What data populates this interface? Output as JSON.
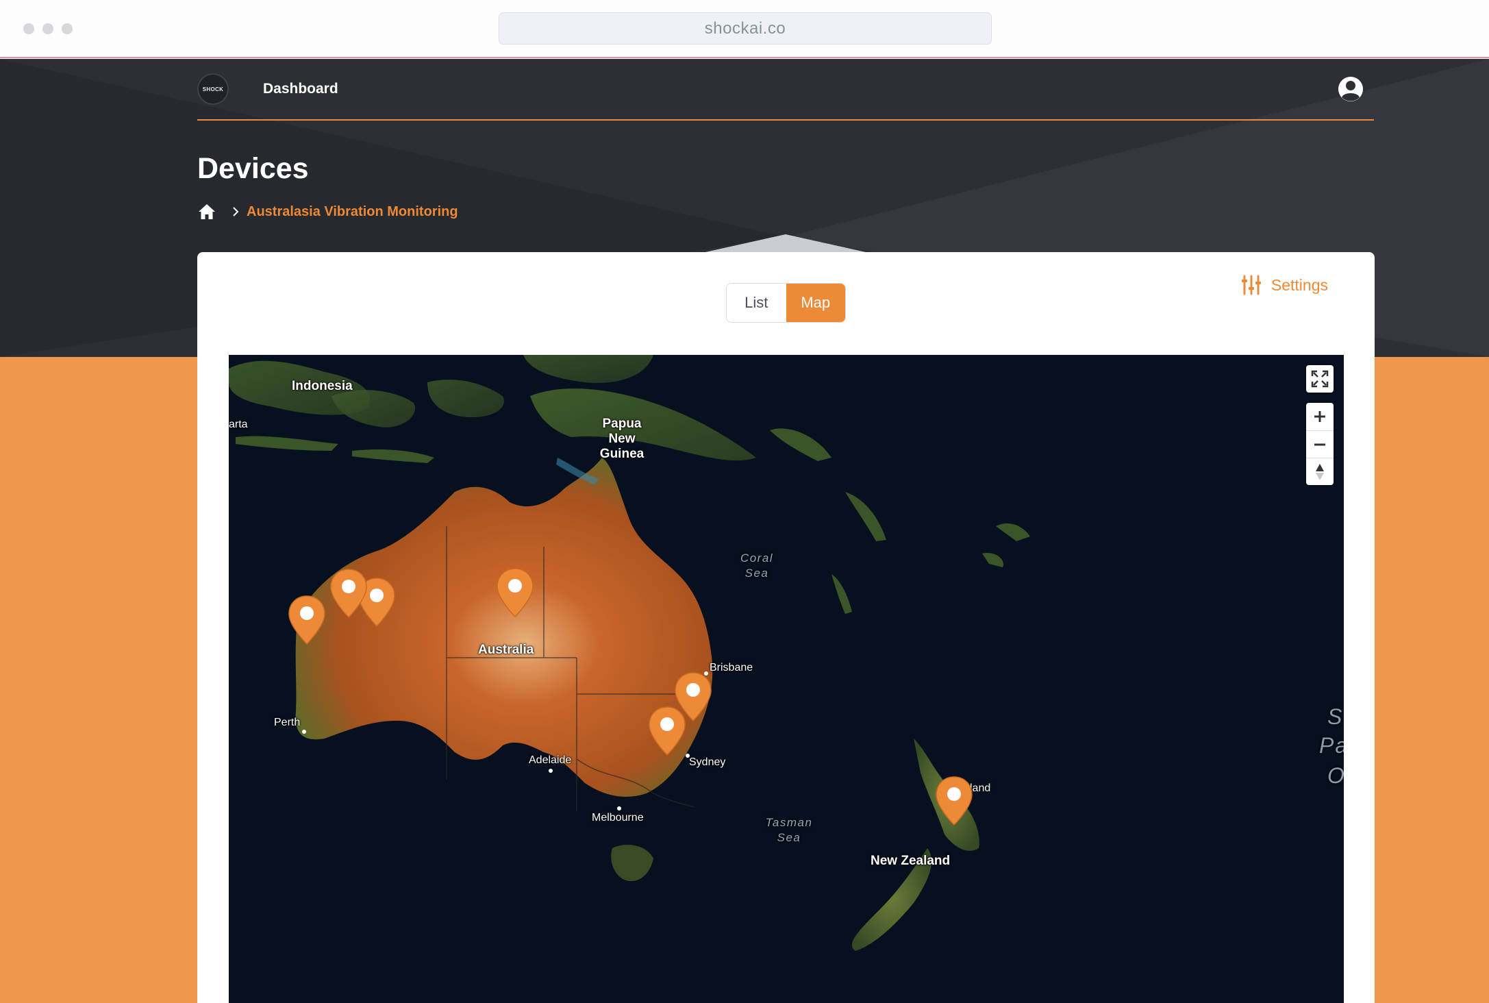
{
  "browser": {
    "url": "shockai.co"
  },
  "nav": {
    "logo_text": "SHOCK",
    "dashboard_label": "Dashboard"
  },
  "page": {
    "title": "Devices",
    "breadcrumb": [
      "Australasia Vibration Monitoring"
    ]
  },
  "view_toggle": {
    "list_label": "List",
    "map_label": "Map",
    "selected": "Map"
  },
  "settings": {
    "label": "Settings"
  },
  "map": {
    "countries": [
      "Indonesia",
      "Papua New Guinea",
      "Australia",
      "New Zealand"
    ],
    "cities": [
      "arta",
      "Brisbane",
      "Perth",
      "Sydney",
      "Adelaide",
      "Melbourne",
      "land"
    ],
    "seas": [
      "Coral Sea",
      "Tasman Sea"
    ],
    "ocean_partial": [
      "S",
      "Pa",
      "O"
    ],
    "marker_count": 7,
    "marker_color": "#ee8a37",
    "controls": [
      "fullscreen-icon",
      "zoom-in-icon",
      "zoom-out-icon",
      "compass-icon"
    ]
  },
  "colors": {
    "accent": "#ee8a37",
    "header_bg": "#2c2f34",
    "band_bg": "#ee974c"
  }
}
